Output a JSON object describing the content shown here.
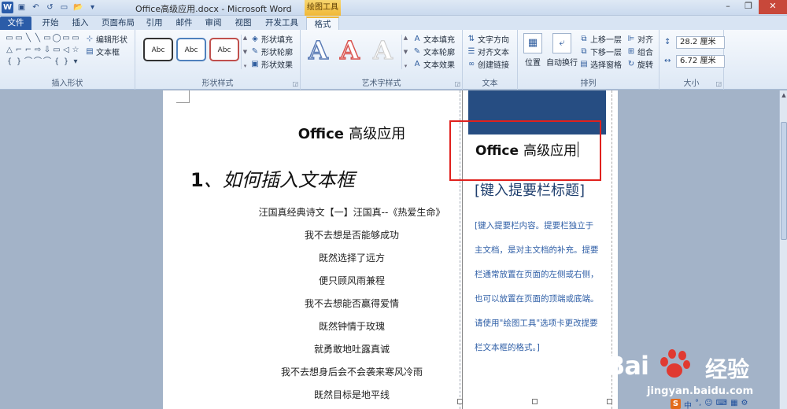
{
  "window": {
    "title": "Office高级应用.docx - Microsoft Word",
    "context_tab_title": "绘图工具",
    "quick_access": [
      "W",
      "▣",
      "↶",
      "↺",
      "▭",
      "📂",
      "▾"
    ],
    "controls": {
      "minimize": "–",
      "restore": "❐",
      "close": "✕"
    }
  },
  "tabs": [
    {
      "label": "文件"
    },
    {
      "label": "开始"
    },
    {
      "label": "插入"
    },
    {
      "label": "页面布局"
    },
    {
      "label": "引用"
    },
    {
      "label": "邮件"
    },
    {
      "label": "审阅"
    },
    {
      "label": "视图"
    },
    {
      "label": "开发工具"
    },
    {
      "label": "格式"
    }
  ],
  "ribbon": {
    "insert_shapes": {
      "label": "插入形状",
      "edit_shape": "编辑形状",
      "text_box": "文本框",
      "shape_glyphs": [
        "▭",
        "▭",
        "╲",
        "╲",
        "▭",
        "◯",
        "▭",
        "▭",
        "△",
        "⌐",
        "⌐",
        "⇨",
        "⇩",
        "▭",
        "◁",
        "☆",
        "{",
        "}",
        "⌒",
        "⌒",
        "⌒",
        "{",
        "}",
        "▾"
      ]
    },
    "shape_styles": {
      "label": "形状样式",
      "styles": [
        "Abc",
        "Abc",
        "Abc"
      ],
      "style_colors": [
        "#333333",
        "#4f81bd",
        "#c0504d"
      ],
      "fill": "形状填充",
      "outline": "形状轮廓",
      "effects": "形状效果"
    },
    "wordart_styles": {
      "label": "艺术字样式",
      "samples": [
        "A",
        "A",
        "A"
      ],
      "sample_colors": [
        "#5a7bb5",
        "#d9534f",
        "#ffffff"
      ],
      "text_fill": "文本填充",
      "text_outline": "文本轮廓",
      "text_effects": "文本效果"
    },
    "text": {
      "label": "文本",
      "direction": "文字方向",
      "align": "对齐文本",
      "link": "创建链接"
    },
    "arrange": {
      "label": "排列",
      "position": "位置",
      "wrap": "自动换行",
      "bring_forward": "上移一层",
      "send_backward": "下移一层",
      "selection_pane": "选择窗格",
      "align": "对齐",
      "group": "组合",
      "rotate": "旋转"
    },
    "size": {
      "label": "大小",
      "height": "28.2 厘米",
      "width": "6.72 厘米"
    }
  },
  "document": {
    "title_latin": "Office",
    "title_cn": "高级应用",
    "heading_number": "1",
    "heading_text": "、如何插入文本框",
    "poem_lines": [
      "汪国真经典诗文【一】汪国真--《热爱生命》",
      "我不去想是否能够成功",
      "既然选择了远方",
      "便只顾风雨兼程",
      "我不去想能否赢得爱情",
      "既然钟情于玫瑰",
      "就勇敢地吐露真诚",
      "我不去想身后会不会袭来寒风冷雨",
      "既然目标是地平线"
    ]
  },
  "sidebar": {
    "title_latin": "Office",
    "title_cn": "高级应用",
    "heading": "[键入提要栏标题]",
    "body_lines": [
      "[键入提要栏内容。提要栏独立于",
      "主文档，是对主文档的补充。提要",
      "栏通常放置在页面的左侧或右侧，",
      "也可以放置在页面的顶端或底端。",
      "请使用\"绘图工具\"选项卡更改提要",
      "栏文本框的格式。]"
    ]
  },
  "watermark": {
    "brand": "Bai",
    "brand_suffix": "经验",
    "url": "jingyan.baidu.com"
  },
  "tray": [
    "S",
    "中",
    "°,",
    "☺",
    "⌨",
    "▦",
    "⚙"
  ]
}
